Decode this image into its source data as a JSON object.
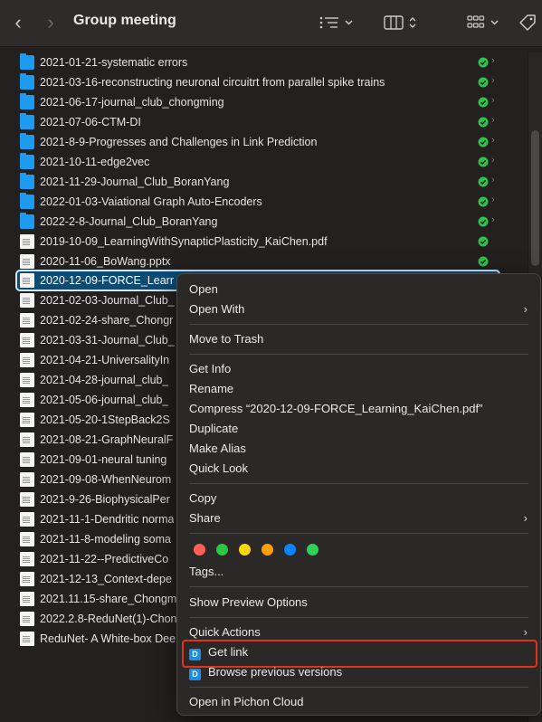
{
  "window": {
    "title": "Group meeting"
  },
  "toolbar": {
    "back": "‹",
    "forward": "›"
  },
  "files": [
    {
      "name": "2021-01-21-systematic errors",
      "kind": "folder",
      "synced": true,
      "chevron": true
    },
    {
      "name": "2021-03-16-reconstructing neuronal circuitrt from parallel spike trains",
      "kind": "folder",
      "synced": true,
      "chevron": true
    },
    {
      "name": "2021-06-17-journal_club_chongming",
      "kind": "folder",
      "synced": true,
      "chevron": true
    },
    {
      "name": "2021-07-06-CTM-DI",
      "kind": "folder",
      "synced": true,
      "chevron": true
    },
    {
      "name": "2021-8-9-Progresses and Challenges in Link Prediction",
      "kind": "folder",
      "synced": true,
      "chevron": true
    },
    {
      "name": "2021-10-11-edge2vec",
      "kind": "folder",
      "synced": true,
      "chevron": true
    },
    {
      "name": "2021-11-29-Journal_Club_BoranYang",
      "kind": "folder",
      "synced": true,
      "chevron": true
    },
    {
      "name": "2022-01-03-Vaiational Graph Auto-Encoders",
      "kind": "folder",
      "synced": true,
      "chevron": true
    },
    {
      "name": "2022-2-8-Journal_Club_BoranYang",
      "kind": "folder",
      "synced": true,
      "chevron": true
    },
    {
      "name": "2019-10-09_LearningWithSynapticPlasticity_KaiChen.pdf",
      "kind": "doc",
      "synced": true,
      "chevron": false
    },
    {
      "name": "2020-11-06_BoWang.pptx",
      "kind": "doc",
      "synced": true,
      "chevron": false
    },
    {
      "name": "2020-12-09-FORCE_Learr",
      "kind": "doc",
      "synced": false,
      "chevron": false,
      "selected": true
    },
    {
      "name": "2021-02-03-Journal_Club_",
      "kind": "doc"
    },
    {
      "name": "2021-02-24-share_Chongr",
      "kind": "doc"
    },
    {
      "name": "2021-03-31-Journal_Club_",
      "kind": "doc"
    },
    {
      "name": "2021-04-21-UniversalityIn",
      "kind": "doc"
    },
    {
      "name": "2021-04-28-journal_club_",
      "kind": "doc"
    },
    {
      "name": "2021-05-06-journal_club_",
      "kind": "doc"
    },
    {
      "name": "2021-05-20-1StepBack2S",
      "kind": "doc"
    },
    {
      "name": "2021-08-21-GraphNeuralF",
      "kind": "doc"
    },
    {
      "name": "2021-09-01-neural tuning",
      "kind": "doc"
    },
    {
      "name": "2021-09-08-WhenNeurom",
      "kind": "doc"
    },
    {
      "name": "2021-9-26-BiophysicalPer",
      "kind": "doc"
    },
    {
      "name": "2021-11-1-Dendritic norma",
      "kind": "doc"
    },
    {
      "name": "2021-11-8-modeling soma",
      "kind": "doc"
    },
    {
      "name": "2021-11-22--PredictiveCo",
      "kind": "doc"
    },
    {
      "name": "2021-12-13_Context-depe",
      "kind": "doc"
    },
    {
      "name": "2021.11.15-share_Chongmi",
      "kind": "doc"
    },
    {
      "name": "2022.2.8-ReduNet(1)-Chon",
      "kind": "doc"
    },
    {
      "name": "ReduNet- A White-box Dee",
      "kind": "doc"
    }
  ],
  "context_menu": {
    "open": "Open",
    "open_with": "Open With",
    "move_to_trash": "Move to Trash",
    "get_info": "Get Info",
    "rename": "Rename",
    "compress": "Compress “2020-12-09-FORCE_Learning_KaiChen.pdf”",
    "duplicate": "Duplicate",
    "make_alias": "Make Alias",
    "quick_look": "Quick Look",
    "copy": "Copy",
    "share": "Share",
    "tags": "Tags...",
    "show_preview_options": "Show Preview Options",
    "quick_actions": "Quick Actions",
    "get_link": "Get link",
    "browse_previous_versions": "Browse previous versions",
    "open_in_pichon_cloud": "Open in Pichon Cloud",
    "submenu_arrow": "›",
    "tag_colors": [
      "#ff5f57",
      "#28c840",
      "#ffd60a",
      "#ff9f0a",
      "#0a84ff",
      "#30d158"
    ],
    "plugin_icon_letter": "D"
  },
  "colors": {
    "selection": "#0e4b73",
    "folder": "#1d9bf0",
    "sync_ok": "#2ec24a",
    "highlight_box": "#e0321f"
  }
}
